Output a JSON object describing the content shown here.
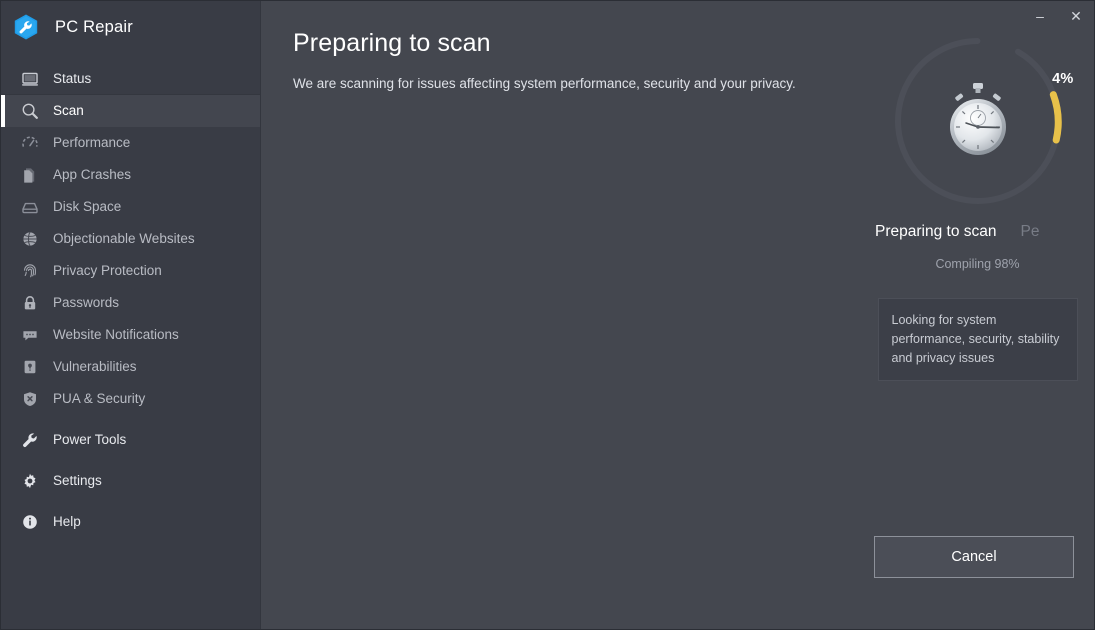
{
  "app": {
    "title": "PC Repair",
    "logo_icon": "wrench-hexagon-icon",
    "accent_color": "#2196e6",
    "progress_color": "#e8c14a",
    "background": "#44474f",
    "sidebar_background": "#393c45"
  },
  "window_controls": {
    "minimize_label": "–",
    "minimize_icon": "minimize-icon",
    "close_label": "✕",
    "close_icon": "close-icon"
  },
  "sidebar": {
    "items": [
      {
        "label": "Status",
        "icon": "monitor-icon",
        "active": false,
        "bright": true
      },
      {
        "label": "Scan",
        "icon": "magnifier-icon",
        "active": true,
        "bright": true
      },
      {
        "label": "Performance",
        "icon": "speedometer-icon",
        "active": false,
        "bright": false
      },
      {
        "label": "App Crashes",
        "icon": "document-crash-icon",
        "active": false,
        "bright": false
      },
      {
        "label": "Disk Space",
        "icon": "harddrive-icon",
        "active": false,
        "bright": false
      },
      {
        "label": "Objectionable Websites",
        "icon": "globe-icon",
        "active": false,
        "bright": false
      },
      {
        "label": "Privacy Protection",
        "icon": "fingerprint-icon",
        "active": false,
        "bright": false
      },
      {
        "label": "Passwords",
        "icon": "lock-icon",
        "active": false,
        "bright": false
      },
      {
        "label": "Website Notifications",
        "icon": "speech-bubble-icon",
        "active": false,
        "bright": false
      },
      {
        "label": "Vulnerabilities",
        "icon": "shield-exclamation-icon",
        "active": false,
        "bright": false
      },
      {
        "label": "PUA & Security",
        "icon": "shield-x-icon",
        "active": false,
        "bright": false
      },
      {
        "label": "Power Tools",
        "icon": "wrench-icon",
        "active": false,
        "bright": true
      },
      {
        "label": "Settings",
        "icon": "gear-icon",
        "active": false,
        "bright": true
      },
      {
        "label": "Help",
        "icon": "info-circle-icon",
        "active": false,
        "bright": true
      }
    ]
  },
  "main": {
    "heading": "Preparing to scan",
    "subheading": "We are scanning for issues affecting system performance, security and your privacy."
  },
  "progress": {
    "percent_label": "4%",
    "percent_value": 4,
    "watch_icon": "stopwatch-icon",
    "stage_current": "Preparing to scan",
    "stage_next": "Pe",
    "compiling_label": "Compiling 98%",
    "tip_text": "Looking for system performance, security, stability and privacy issues"
  },
  "actions": {
    "cancel_label": "Cancel"
  }
}
